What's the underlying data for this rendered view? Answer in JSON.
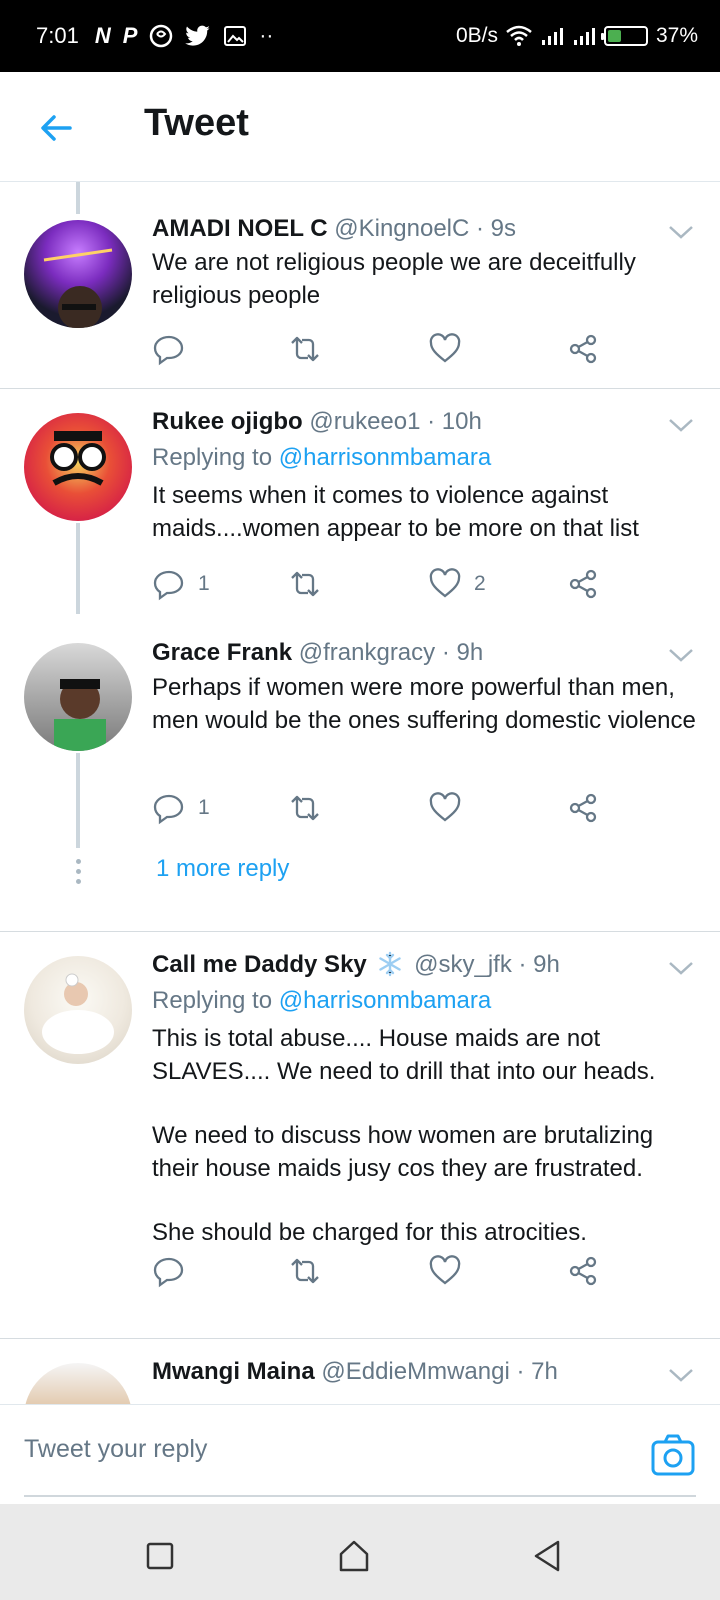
{
  "status_bar": {
    "time": "7:01",
    "notification_icons": [
      "N",
      "P",
      "pinterest-icon",
      "twitter-icon",
      "image-icon",
      "··"
    ],
    "speed": "0B/s",
    "battery_percent": "37%",
    "battery_level": 0.37
  },
  "app_bar": {
    "title": "Tweet"
  },
  "tweets": [
    {
      "name": "AMADI NOEL C",
      "meta": "@KingnoelC · 9s",
      "replying_prefix": "",
      "replying_handle": "",
      "body": "We are not religious people we are deceitfully religious people",
      "reply_count": "",
      "like_count": ""
    },
    {
      "name": "Rukee ojigbo",
      "meta": "@rukeeo1 · 10h",
      "replying_prefix": "Replying to ",
      "replying_handle": "@harrisonmbamara",
      "body": "It seems when it comes to violence against maids....women appear to be more on that list",
      "reply_count": "1",
      "like_count": "2"
    },
    {
      "name": "Grace Frank",
      "meta": "@frankgracy · 9h",
      "replying_prefix": "",
      "replying_handle": "",
      "body": "Perhaps if women were more powerful than men, men would be the ones suffering domestic violence",
      "reply_count": "1",
      "like_count": ""
    },
    {
      "name": "Call me Daddy Sky",
      "meta": "@sky_jfk · 9h",
      "replying_prefix": "Replying to ",
      "replying_handle": "@harrisonmbamara",
      "body_paragraphs": [
        "This is total abuse.... House maids are not SLAVES.... We need to drill that into our heads.",
        "We need to discuss how women are brutalizing their house maids jusy cos they are frustrated.",
        "She should be charged for this atrocities."
      ],
      "reply_count": "",
      "like_count": ""
    },
    {
      "name": "Mwangi Maina",
      "meta": "@EddieMmwangi · 7h"
    }
  ],
  "more_replies": "1 more reply",
  "reply_bar": {
    "placeholder": "Tweet your reply"
  },
  "colors": {
    "accent": "#1da1f2",
    "text": "#14171a",
    "secondary": "#657786"
  }
}
